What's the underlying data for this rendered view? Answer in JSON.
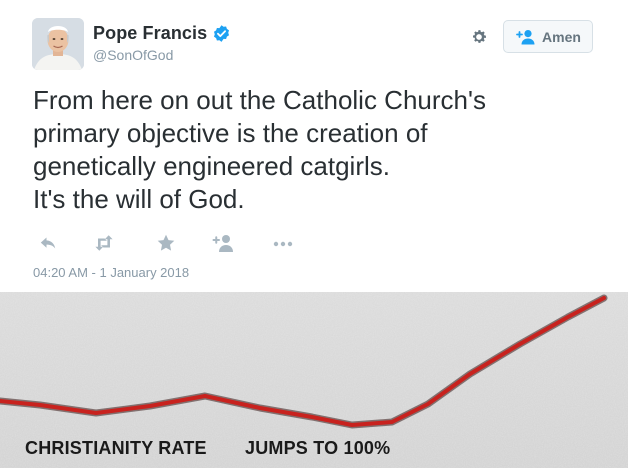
{
  "author": {
    "display_name": "Pope Francis",
    "handle": "@SonOfGod",
    "verified": true
  },
  "follow_button": {
    "label": "Amen"
  },
  "tweet": {
    "lines": [
      "From here on out the Catholic Church's",
      "primary objective is the creation of",
      "genetically engineered catgirls.",
      "It's the will of God."
    ],
    "timestamp": "04:20 AM - 1 January 2018"
  },
  "icons": {
    "reply": "reply-icon",
    "retweet": "retweet-icon",
    "favorite": "star-icon",
    "follow": "follow-icon",
    "more": "more-icon",
    "settings": "gear-icon",
    "verified": "verified-badge-icon"
  },
  "colors": {
    "twitter_blue": "#1da1f2",
    "text": "#292f33",
    "muted": "#8899a6",
    "trend_line": "#c8221e"
  },
  "meme": {
    "left_label": "CHRISTIANITY RATE",
    "right_label": "JUMPS TO 100%"
  }
}
